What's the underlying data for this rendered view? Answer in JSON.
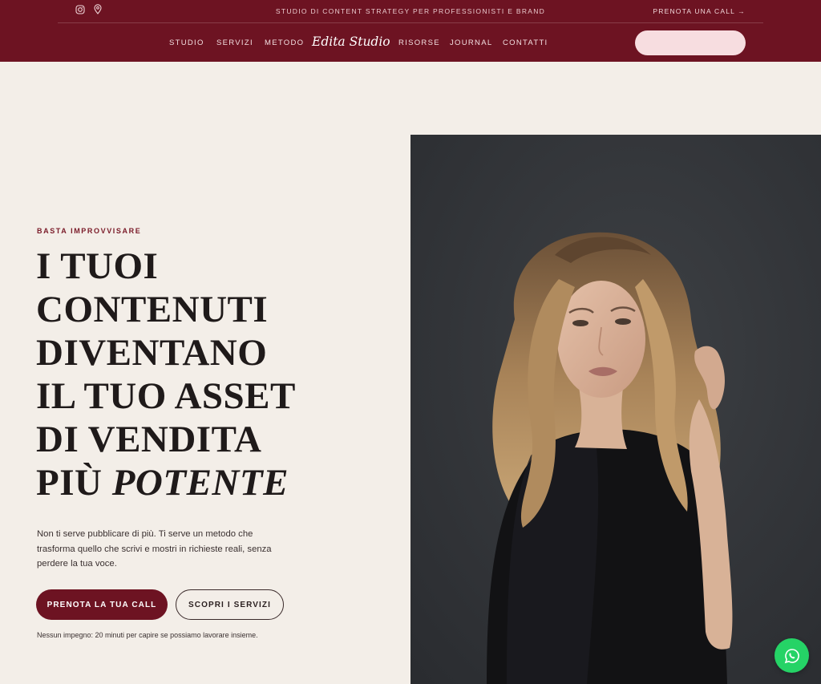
{
  "topbar": {
    "tagline": "Studio di content strategy per professionisti e brand",
    "cta_label": "PRENOTA UNA CALL →",
    "social_icons": [
      "instagram-icon",
      "map-pin-icon"
    ]
  },
  "nav": {
    "brand": "Edita Studio",
    "items": [
      "Studio",
      "Servizi",
      "Metodo",
      "Risorse",
      "Journal",
      "Contatti"
    ],
    "pill_color": "#f7dde0"
  },
  "hero": {
    "kicker": "Basta improvvisare",
    "headline_lines": [
      "I tuoi",
      "contenuti",
      "diventano",
      "il tuo asset",
      "di vendita"
    ],
    "headline_last_prefix": "più ",
    "headline_last_emphasis": "potente",
    "lead": "Non ti serve pubblicare di più. Ti serve un metodo che trasforma quello che scrivi e mostri in richieste reali, senza perdere la tua voce.",
    "primary_button": "Prenota la tua call",
    "secondary_button": "Scopri i servizi",
    "note": "Nessun impegno: 20 minuti per capire se possiamo lavorare insieme."
  },
  "colors": {
    "brand": "#6d1322",
    "background": "#f3eee8",
    "whatsapp": "#25d366"
  },
  "floating": {
    "whatsapp_icon": "whatsapp-icon"
  }
}
